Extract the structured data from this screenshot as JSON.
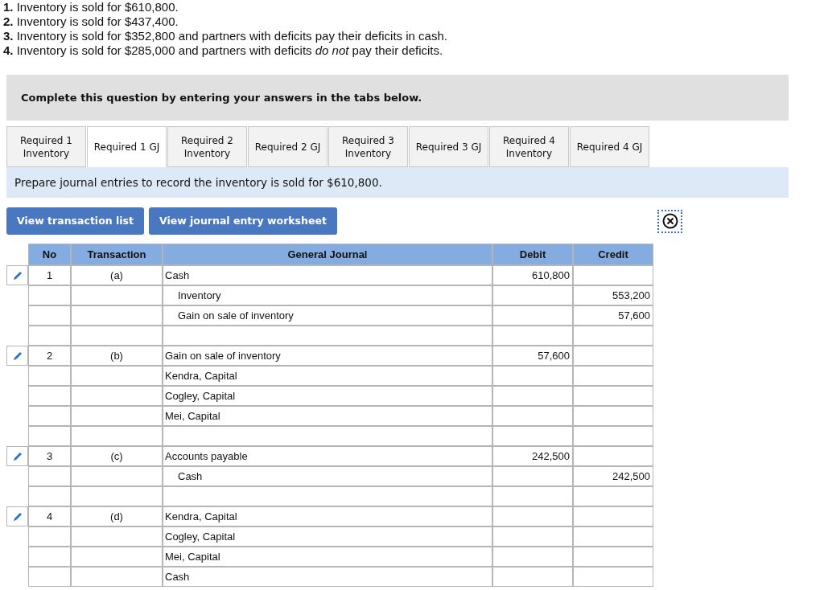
{
  "questions": [
    "**1.** Inventory is sold for $610,800.",
    "**2.** Inventory is sold for $437,400.",
    "**3.** Inventory is sold for $352,800 and partners with deficits pay their deficits in cash.",
    "**4.** Inventory is sold for $285,000 and partners with deficits *do not* pay their deficits."
  ],
  "instruction": "Complete this question by entering your answers in the tabs below.",
  "tabs": [
    {
      "line1": "Required 1",
      "line2": "Inventory",
      "selected": false
    },
    {
      "line1": "Required 1 GJ",
      "selected": true
    },
    {
      "line1": "Required 2",
      "line2": "Inventory",
      "selected": false
    },
    {
      "line1": "Required 2 GJ",
      "selected": false
    },
    {
      "line1": "Required 3",
      "line2": "Inventory",
      "selected": false
    },
    {
      "line1": "Required 3 GJ",
      "selected": false
    },
    {
      "line1": "Required 4",
      "line2": "Inventory",
      "selected": false
    },
    {
      "line1": "Required 4 GJ",
      "selected": false
    }
  ],
  "prompt": "Prepare journal entries to record the inventory is sold for $610,800.",
  "buttons": [
    "View transaction list",
    "View journal entry worksheet"
  ],
  "table": {
    "columns": [
      "No",
      "Transaction",
      "General Journal",
      "Debit",
      "Credit"
    ],
    "entries": [
      {
        "no": "1",
        "transaction": "(a)",
        "rows": [
          {
            "kind": "line",
            "account": "Cash",
            "indented": false,
            "debit": "610,800"
          },
          {
            "kind": "line",
            "account": "Inventory",
            "indented": true,
            "credit": "553,200"
          },
          {
            "kind": "line",
            "account": "Gain on sale of inventory",
            "indented": true,
            "credit": "57,600"
          },
          {
            "kind": "blank"
          }
        ]
      },
      {
        "no": "2",
        "transaction": "(b)",
        "rows": [
          {
            "kind": "line",
            "account": "Gain on sale of inventory",
            "indented": false,
            "debit": "57,600"
          },
          {
            "kind": "line",
            "account": "Kendra, Capital",
            "indented": false
          },
          {
            "kind": "line",
            "account": "Cogley, Capital",
            "indented": false
          },
          {
            "kind": "line",
            "account": "Mei, Capital",
            "indented": false
          },
          {
            "kind": "blank"
          }
        ]
      },
      {
        "no": "3",
        "transaction": "(c)",
        "rows": [
          {
            "kind": "line",
            "account": "Accounts payable",
            "indented": false,
            "debit": "242,500"
          },
          {
            "kind": "line",
            "account": "Cash",
            "indented": true,
            "credit": "242,500"
          },
          {
            "kind": "blank"
          }
        ]
      },
      {
        "no": "4",
        "transaction": "(d)",
        "rows": [
          {
            "kind": "line",
            "account": "Kendra, Capital",
            "indented": false
          },
          {
            "kind": "line",
            "account": "Cogley, Capital",
            "indented": false
          },
          {
            "kind": "line",
            "account": "Mei, Capital",
            "indented": false
          },
          {
            "kind": "line",
            "account": "Cash",
            "indented": false
          }
        ]
      }
    ]
  }
}
